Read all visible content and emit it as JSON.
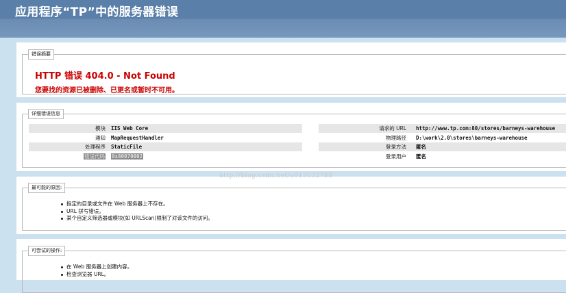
{
  "header": {
    "title": "应用程序“TP”中的服务器错误"
  },
  "summary": {
    "legend": "错误摘要",
    "title": "HTTP 错误 404.0 - Not Found",
    "message": "您要找的资源已被删除、已更名或暂时不可用。"
  },
  "details": {
    "legend": "详细错误信息",
    "left": [
      {
        "label": "模块",
        "value": "IIS Web Core"
      },
      {
        "label": "通知",
        "value": "MapRequestHandler"
      },
      {
        "label": "处理程序",
        "value": "StaticFile"
      },
      {
        "label": "错误代码",
        "value": "0x80070002"
      }
    ],
    "right": [
      {
        "label": "请求的 URL",
        "value": "http://www.tp.com:80/stores/barneys-warehouse"
      },
      {
        "label": "物理路径",
        "value": "D:\\work\\2.0\\stores\\barneys-warehouse"
      },
      {
        "label": "登录方法",
        "value": "匿名"
      },
      {
        "label": "登录用户",
        "value": "匿名"
      }
    ]
  },
  "causes": {
    "legend": "最可能的原因:",
    "items": [
      "指定的目录或文件在 Web 服务器上不存在。",
      "URL 拼写错误。",
      "某个自定义筛选器或模块(如 URLScan)限制了对该文件的访问。"
    ]
  },
  "actions": {
    "legend": "可尝试的操作:",
    "items": [
      "在 Web 服务器上创建内容。",
      "检查浏览器 URL。"
    ]
  },
  "watermark": "http://blog.csdn.net/u013032788"
}
